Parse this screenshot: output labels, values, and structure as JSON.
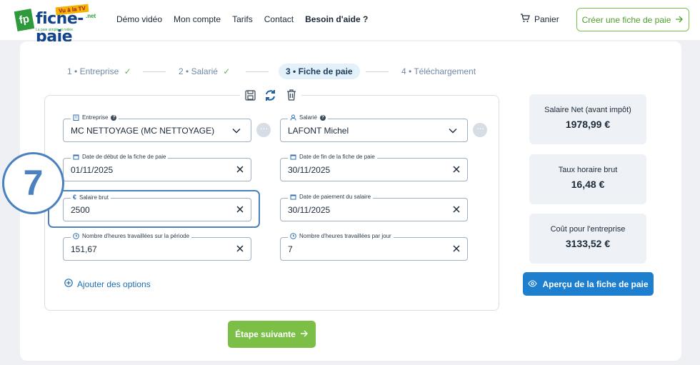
{
  "header": {
    "logo": {
      "brand": "fiche-paie",
      "tv": "Vu à la TV",
      "net": ".net",
      "tagline": "La paie simple et rodée",
      "badge": "fp"
    },
    "nav": [
      "Démo vidéo",
      "Mon compte",
      "Tarifs",
      "Contact",
      "Besoin d'aide ?"
    ],
    "cart_label": "Panier",
    "create_button": "Créer une fiche de paie"
  },
  "steps": [
    {
      "num": "1 •",
      "label": "Entreprise",
      "done": true
    },
    {
      "num": "2 •",
      "label": "Salarié",
      "done": true
    },
    {
      "num": "3 •",
      "label": "Fiche de paie",
      "active": true
    },
    {
      "num": "4 •",
      "label": "Téléchargement"
    }
  ],
  "form": {
    "entreprise": {
      "label": "Entreprise",
      "value": "MC NETTOYAGE (MC NETTOYAGE)"
    },
    "salarie": {
      "label": "Salarié",
      "value": "LAFONT Michel"
    },
    "date_debut": {
      "label": "Date de début de la fiche de paie",
      "value": "01/11/2025"
    },
    "date_fin": {
      "label": "Date de fin de la fiche de paie",
      "value": "30/11/2025"
    },
    "salaire_brut": {
      "label": "Salaire brut",
      "value": "2500"
    },
    "date_paiement": {
      "label": "Date de paiement du salaire",
      "value": "30/11/2025"
    },
    "heures_periode": {
      "label": "Nombre d'heures travaillées sur la période",
      "value": "151,67"
    },
    "heures_jour": {
      "label": "Nombre d'heures travaillées par jour",
      "value": "7"
    },
    "add_options": "Ajouter des options",
    "next_button": "Étape suivante"
  },
  "annotation": {
    "step_number": "7"
  },
  "summary": [
    {
      "label": "Salaire Net (avant impôt)",
      "value": "1978,99 €"
    },
    {
      "label": "Taux horaire brut",
      "value": "16,48 €"
    },
    {
      "label": "Coût pour l'entreprise",
      "value": "3133,52 €"
    }
  ],
  "preview_button": "Aperçu de la fiche de paie",
  "colors": {
    "accent_green": "#7cbf46",
    "accent_blue": "#1f7fcf",
    "highlight": "#4b81c1"
  }
}
